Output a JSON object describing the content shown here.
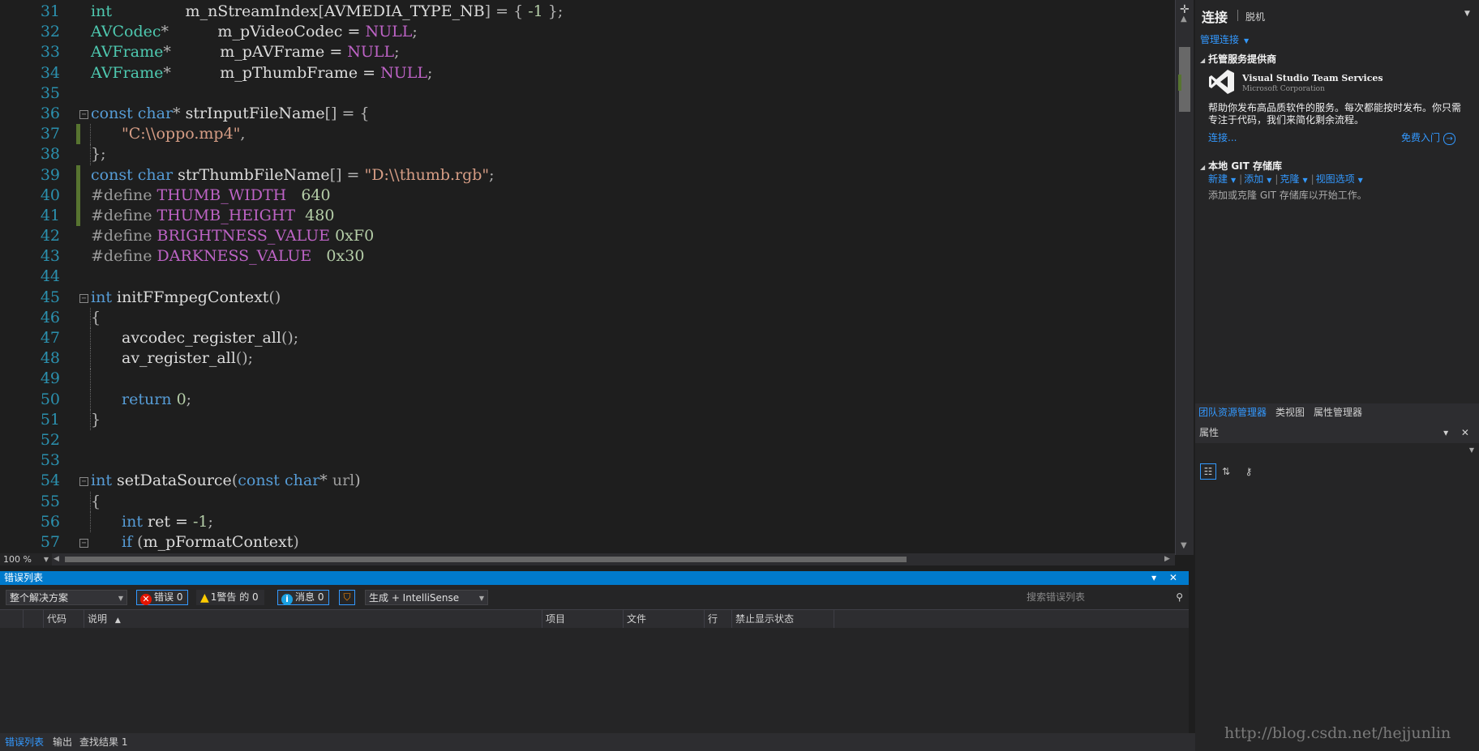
{
  "editor": {
    "lines": [
      {
        "n": "31",
        "mod": false,
        "fold": "",
        "guide": false,
        "indent": 0,
        "tokens": [
          [
            "ty",
            "int"
          ],
          [
            "id",
            "               m_nStreamIndex"
          ],
          [
            "pun",
            "["
          ],
          [
            "id",
            "AVMEDIA_TYPE_NB"
          ],
          [
            "pun",
            "] = { "
          ],
          [
            "num",
            "-1"
          ],
          [
            "pun",
            " };"
          ]
        ]
      },
      {
        "n": "32",
        "mod": false,
        "fold": "",
        "guide": false,
        "indent": 0,
        "tokens": [
          [
            "ty",
            "AVCodec"
          ],
          [
            "pun",
            "*"
          ],
          [
            "id",
            "          m_pVideoCodec = "
          ],
          [
            "mac",
            "NULL"
          ],
          [
            "pun",
            ";"
          ]
        ]
      },
      {
        "n": "33",
        "mod": false,
        "fold": "",
        "guide": false,
        "indent": 0,
        "tokens": [
          [
            "ty",
            "AVFrame"
          ],
          [
            "pun",
            "*"
          ],
          [
            "id",
            "          m_pAVFrame = "
          ],
          [
            "mac",
            "NULL"
          ],
          [
            "pun",
            ";"
          ]
        ]
      },
      {
        "n": "34",
        "mod": false,
        "fold": "",
        "guide": false,
        "indent": 0,
        "tokens": [
          [
            "ty",
            "AVFrame"
          ],
          [
            "pun",
            "*"
          ],
          [
            "id",
            "          m_pThumbFrame = "
          ],
          [
            "mac",
            "NULL"
          ],
          [
            "pun",
            ";"
          ]
        ]
      },
      {
        "n": "35",
        "mod": false,
        "fold": "",
        "guide": false,
        "indent": 0,
        "tokens": []
      },
      {
        "n": "36",
        "mod": false,
        "fold": "open",
        "guide": false,
        "indent": 0,
        "tokens": [
          [
            "kw",
            "const"
          ],
          [
            "id",
            " "
          ],
          [
            "kw",
            "char"
          ],
          [
            "pun",
            "* "
          ],
          [
            "id",
            "strInputFileName"
          ],
          [
            "pun",
            "[] = {"
          ]
        ]
      },
      {
        "n": "37",
        "mod": true,
        "fold": "",
        "guide": true,
        "indent": 1,
        "tokens": [
          [
            "str",
            "\"C:\\\\oppo.mp4\""
          ],
          [
            "pun",
            ","
          ]
        ]
      },
      {
        "n": "38",
        "mod": false,
        "fold": "",
        "guide": true,
        "indent": 0,
        "tokens": [
          [
            "pun",
            "};"
          ]
        ]
      },
      {
        "n": "39",
        "mod": true,
        "fold": "",
        "guide": false,
        "indent": 0,
        "tokens": [
          [
            "kw",
            "const"
          ],
          [
            "id",
            " "
          ],
          [
            "kw",
            "char"
          ],
          [
            "id",
            " strThumbFileName"
          ],
          [
            "pun",
            "[] = "
          ],
          [
            "str",
            "\"D:\\\\thumb.rgb\""
          ],
          [
            "pun",
            ";"
          ]
        ]
      },
      {
        "n": "40",
        "mod": true,
        "fold": "",
        "guide": false,
        "indent": 0,
        "tokens": [
          [
            "pp",
            "#define"
          ],
          [
            "id",
            " "
          ],
          [
            "mac",
            "THUMB_WIDTH"
          ],
          [
            "id",
            "   "
          ],
          [
            "num",
            "640"
          ]
        ]
      },
      {
        "n": "41",
        "mod": true,
        "fold": "",
        "guide": false,
        "indent": 0,
        "tokens": [
          [
            "pp",
            "#define"
          ],
          [
            "id",
            " "
          ],
          [
            "mac",
            "THUMB_HEIGHT"
          ],
          [
            "id",
            "  "
          ],
          [
            "num",
            "480"
          ]
        ]
      },
      {
        "n": "42",
        "mod": false,
        "fold": "",
        "guide": false,
        "indent": 0,
        "tokens": [
          [
            "pp",
            "#define"
          ],
          [
            "id",
            " "
          ],
          [
            "mac",
            "BRIGHTNESS_VALUE"
          ],
          [
            "id",
            " "
          ],
          [
            "num",
            "0xF0"
          ]
        ]
      },
      {
        "n": "43",
        "mod": false,
        "fold": "",
        "guide": false,
        "indent": 0,
        "tokens": [
          [
            "pp",
            "#define"
          ],
          [
            "id",
            " "
          ],
          [
            "mac",
            "DARKNESS_VALUE"
          ],
          [
            "id",
            "   "
          ],
          [
            "num",
            "0x30"
          ]
        ]
      },
      {
        "n": "44",
        "mod": false,
        "fold": "",
        "guide": false,
        "indent": 0,
        "tokens": []
      },
      {
        "n": "45",
        "mod": false,
        "fold": "open",
        "guide": false,
        "indent": 0,
        "tokens": [
          [
            "kw",
            "int"
          ],
          [
            "id",
            " initFFmpegContext"
          ],
          [
            "pun",
            "()"
          ]
        ]
      },
      {
        "n": "46",
        "mod": false,
        "fold": "",
        "guide": true,
        "indent": 0,
        "tokens": [
          [
            "pun",
            "{"
          ]
        ]
      },
      {
        "n": "47",
        "mod": false,
        "fold": "",
        "guide": true,
        "indent": 1,
        "tokens": [
          [
            "id",
            "avcodec_register_all"
          ],
          [
            "pun",
            "();"
          ]
        ]
      },
      {
        "n": "48",
        "mod": false,
        "fold": "",
        "guide": true,
        "indent": 1,
        "tokens": [
          [
            "id",
            "av_register_all"
          ],
          [
            "pun",
            "();"
          ]
        ]
      },
      {
        "n": "49",
        "mod": false,
        "fold": "",
        "guide": true,
        "indent": 0,
        "tokens": []
      },
      {
        "n": "50",
        "mod": false,
        "fold": "",
        "guide": true,
        "indent": 1,
        "tokens": [
          [
            "kw",
            "return"
          ],
          [
            "id",
            " "
          ],
          [
            "num",
            "0"
          ],
          [
            "pun",
            ";"
          ]
        ]
      },
      {
        "n": "51",
        "mod": false,
        "fold": "",
        "guide": true,
        "indent": 0,
        "tokens": [
          [
            "pun",
            "}"
          ]
        ]
      },
      {
        "n": "52",
        "mod": false,
        "fold": "",
        "guide": false,
        "indent": 0,
        "tokens": []
      },
      {
        "n": "53",
        "mod": false,
        "fold": "",
        "guide": false,
        "indent": 0,
        "tokens": []
      },
      {
        "n": "54",
        "mod": false,
        "fold": "open",
        "guide": false,
        "indent": 0,
        "tokens": [
          [
            "kw",
            "int"
          ],
          [
            "id",
            " setDataSource"
          ],
          [
            "pun",
            "("
          ],
          [
            "kw",
            "const"
          ],
          [
            "id",
            " "
          ],
          [
            "kw",
            "char"
          ],
          [
            "pun",
            "* "
          ],
          [
            "pp",
            "url"
          ],
          [
            "pun",
            ")"
          ]
        ]
      },
      {
        "n": "55",
        "mod": false,
        "fold": "",
        "guide": true,
        "indent": 0,
        "tokens": [
          [
            "pun",
            "{"
          ]
        ]
      },
      {
        "n": "56",
        "mod": false,
        "fold": "",
        "guide": true,
        "indent": 1,
        "tokens": [
          [
            "kw",
            "int"
          ],
          [
            "id",
            " ret = "
          ],
          [
            "num",
            "-1"
          ],
          [
            "pun",
            ";"
          ]
        ]
      },
      {
        "n": "57",
        "mod": false,
        "fold": "open",
        "guide": true,
        "indent": 1,
        "tokens": [
          [
            "kw",
            "if"
          ],
          [
            "id",
            " "
          ],
          [
            "pun",
            "("
          ],
          [
            "id",
            "m_pFormatContext"
          ],
          [
            "pun",
            ")"
          ]
        ]
      }
    ],
    "zoom": "100 %"
  },
  "error_list": {
    "title": "错误列表",
    "controls": "▾ ✕",
    "scope": "整个解决方案",
    "errors_label": "错误 0",
    "warnings_label": "1警告 的 0",
    "messages_label": "消息 0",
    "build_filter": "生成 + IntelliSense",
    "search_placeholder": "搜索错误列表",
    "columns": {
      "code": "代码",
      "description": "说明",
      "project": "项目",
      "file": "文件",
      "line": "行",
      "suppression": "禁止显示状态"
    }
  },
  "bottom_tabs": [
    "错误列表",
    "输出",
    "查找结果 1"
  ],
  "team_explorer": {
    "title": "连接",
    "offline": "脱机",
    "manage": "管理连接",
    "hosted_title": "托管服务提供商",
    "vs_name": "Visual Studio Team Services",
    "vs_corp": "Microsoft Corporation",
    "vs_desc": "帮助你发布高品质软件的服务。每次都能按时发布。你只需专注于代码，我们来简化剩余流程。",
    "connect": "连接...",
    "free": "免费入门",
    "git_title": "本地 GIT 存储库",
    "git_new": "新建",
    "git_add": "添加",
    "git_clone": "克隆",
    "git_view": "视图选项",
    "git_hint": "添加或克隆 GIT 存储库以开始工作。"
  },
  "right_tabs": [
    "团队资源管理器",
    "类视图",
    "属性管理器"
  ],
  "properties": {
    "title": "属性",
    "controls": "▾ ✕"
  },
  "watermark": "http://blog.csdn.net/hejjunlin",
  "colors": {
    "accent": "#007acc",
    "keyword": "#569cd6",
    "type": "#4ec9b0",
    "macro": "#bd63c5",
    "string": "#d69d85",
    "number": "#b5cea8"
  }
}
